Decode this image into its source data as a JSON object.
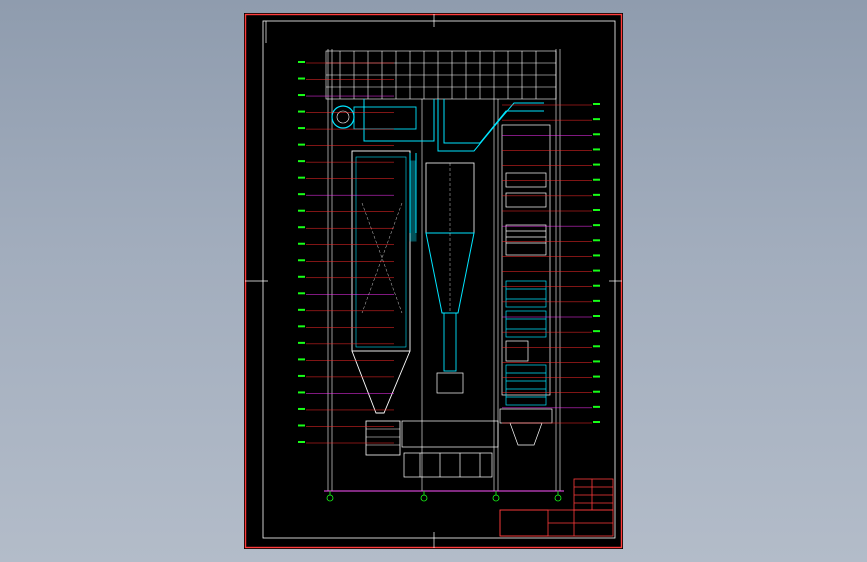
{
  "viewport": {
    "background_top": "#8f9cae",
    "background_bottom": "#b3bcc9"
  },
  "drawing": {
    "sheet_color": "#000000",
    "colors": {
      "frame": "#ff3b3b",
      "linework": "#ffffff",
      "ducts": "#00e5ff",
      "callouts": "#ff2b2b",
      "labels": "#18ff18",
      "markers": "#ff33ff",
      "notes": "#ffff33",
      "grid_axis": "#ff55ff"
    },
    "icons": [
      "boiler-furnace-icon",
      "steam-drum-icon",
      "cyclone-separator-icon",
      "tail-flue-heat-exchanger-icon",
      "air-preheater-icon"
    ],
    "callout_count_left": 24,
    "callout_count_right": 22,
    "grid_axes": 4
  },
  "title_block": {
    "cells": 5
  }
}
